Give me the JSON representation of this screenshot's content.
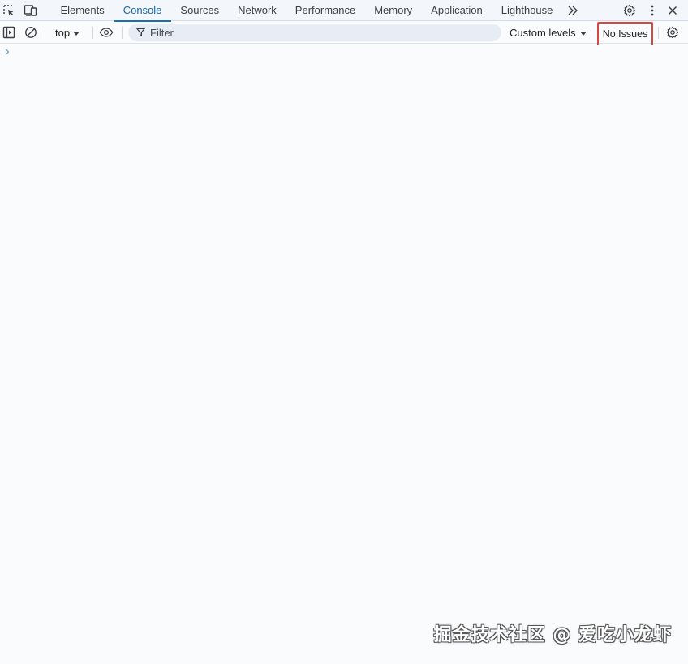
{
  "tabbar": {
    "left_icons": [
      "inspect-element-icon",
      "device-toolbar-icon"
    ],
    "tabs": [
      {
        "label": "Elements",
        "active": false
      },
      {
        "label": "Console",
        "active": true
      },
      {
        "label": "Sources",
        "active": false
      },
      {
        "label": "Network",
        "active": false
      },
      {
        "label": "Performance",
        "active": false
      },
      {
        "label": "Memory",
        "active": false
      },
      {
        "label": "Application",
        "active": false
      },
      {
        "label": "Lighthouse",
        "active": false
      }
    ],
    "more_tabs_icon": "double-chevron-right-icon",
    "right_icons": [
      "gear-icon",
      "kebab-menu-icon",
      "close-icon"
    ]
  },
  "toolbar": {
    "sidebar_toggle_icon": "sidebar-toggle-icon",
    "clear_icon": "clear-console-icon",
    "context": "top",
    "eye_icon": "live-expression-eye-icon",
    "filter": {
      "placeholder": "Filter",
      "value": ""
    },
    "levels_label": "Custom levels",
    "issues_label": "No Issues",
    "settings_icon": "gear-icon"
  },
  "console": {
    "prompt_icon": "chevron-right-icon"
  },
  "watermark": "掘金技术社区 @ 爱吃小龙虾",
  "colors": {
    "accent": "#1b6fb0",
    "highlight_border": "#d9463e",
    "tabbar_bg": "#f3f6fb",
    "body_bg": "#f9fbfd",
    "filter_bg": "#e6edf5"
  }
}
